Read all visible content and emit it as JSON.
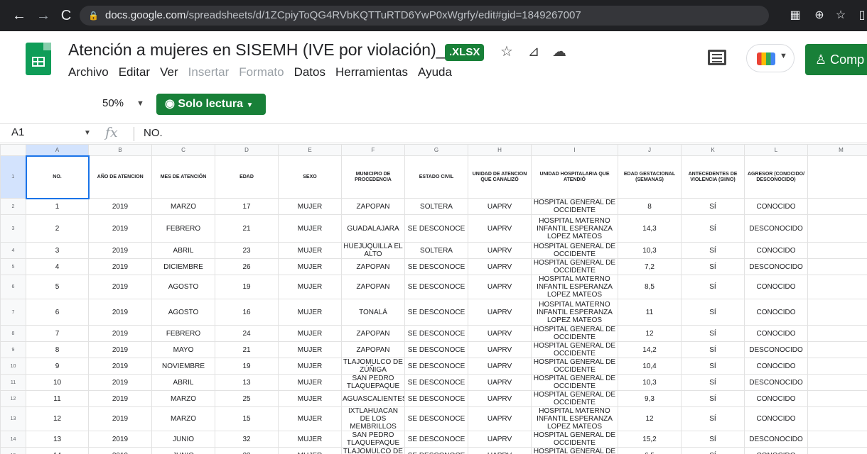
{
  "browser": {
    "url_host": "docs.google.com",
    "url_path": "/spreadsheets/d/1ZCpiyToQG4RVbKQTTuRTD6YwP0xWgrfy/edit#gid=1849267007"
  },
  "doc": {
    "title": "Atención a mujeres en SISEMH (IVE por violación)_1",
    "badge": ".XLSX"
  },
  "menu": {
    "items": [
      "Archivo",
      "Editar",
      "Ver",
      "Insertar",
      "Formato",
      "Datos",
      "Herramientas",
      "Ayuda"
    ],
    "disabled": [
      "Insertar",
      "Formato"
    ]
  },
  "toolbar": {
    "zoom": "50%",
    "mode_label": "Solo lectura"
  },
  "share": {
    "label": "Comp"
  },
  "formula": {
    "cell": "A1",
    "content": "NO."
  },
  "sheet": {
    "col_letters": [
      "A",
      "B",
      "C",
      "D",
      "E",
      "F",
      "G",
      "H",
      "I",
      "J",
      "K",
      "L",
      "M"
    ],
    "headers": [
      "NO.",
      "AÑO DE ATENCION",
      "MES DE ATENCIÓN",
      "EDAD",
      "SEXO",
      "MUNICIPIO DE PROCEDENCIA",
      "ESTADO CIVIL",
      "UNIDAD DE ATENCION QUE CANALIZÓ",
      "UNIDAD HOSPITALARIA QUE ATENDIÓ",
      "EDAD GESTACIONAL (SEMANAS)",
      "ANTECEDENTES DE VIOLENCIA (SI/NO)",
      "AGRESOR (CONOCIDO/ DESCONOCIDO)",
      ""
    ],
    "rows": [
      [
        "1",
        "2019",
        "MARZO",
        "17",
        "MUJER",
        "ZAPOPAN",
        "SOLTERA",
        "UAPRV",
        "HOSPITAL GENERAL DE OCCIDENTE",
        "8",
        "SÍ",
        "CONOCIDO"
      ],
      [
        "2",
        "2019",
        "FEBRERO",
        "21",
        "MUJER",
        "GUADALAJARA",
        "SE DESCONOCE",
        "UAPRV",
        "HOSPITAL MATERNO INFANTIL ESPERANZA LOPEZ MATEOS",
        "14,3",
        "SÍ",
        "DESCONOCIDO"
      ],
      [
        "3",
        "2019",
        "ABRIL",
        "23",
        "MUJER",
        "HUEJUQUILLA EL ALTO",
        "SOLTERA",
        "UAPRV",
        "HOSPITAL GENERAL DE OCCIDENTE",
        "10,3",
        "SÍ",
        "CONOCIDO"
      ],
      [
        "4",
        "2019",
        "DICIEMBRE",
        "26",
        "MUJER",
        "ZAPOPAN",
        "SE DESCONOCE",
        "UAPRV",
        "HOSPITAL GENERAL DE OCCIDENTE",
        "7,2",
        "SÍ",
        "DESCONOCIDO"
      ],
      [
        "5",
        "2019",
        "AGOSTO",
        "19",
        "MUJER",
        "ZAPOPAN",
        "SE DESCONOCE",
        "UAPRV",
        "HOSPITAL MATERNO INFANTIL ESPERANZA LOPEZ MATEOS",
        "8,5",
        "SÍ",
        "CONOCIDO"
      ],
      [
        "6",
        "2019",
        "AGOSTO",
        "16",
        "MUJER",
        "TONALÁ",
        "SE DESCONOCE",
        "UAPRV",
        "HOSPITAL MATERNO INFANTIL ESPERANZA LOPEZ MATEOS",
        "11",
        "SÍ",
        "CONOCIDO"
      ],
      [
        "7",
        "2019",
        "FEBRERO",
        "24",
        "MUJER",
        "ZAPOPAN",
        "SE DESCONOCE",
        "UAPRV",
        "HOSPITAL GENERAL DE OCCIDENTE",
        "12",
        "SÍ",
        "CONOCIDO"
      ],
      [
        "8",
        "2019",
        "MAYO",
        "21",
        "MUJER",
        "ZAPOPAN",
        "SE DESCONOCE",
        "UAPRV",
        "HOSPITAL GENERAL DE OCCIDENTE",
        "14,2",
        "SÍ",
        "DESCONOCIDO"
      ],
      [
        "9",
        "2019",
        "NOVIEMBRE",
        "19",
        "MUJER",
        "TLAJOMULCO DE ZÚÑIGA",
        "SE DESCONOCE",
        "UAPRV",
        "HOSPITAL GENERAL DE OCCIDENTE",
        "10,4",
        "SÍ",
        "CONOCIDO"
      ],
      [
        "10",
        "2019",
        "ABRIL",
        "13",
        "MUJER",
        "SAN PEDRO TLAQUEPAQUE",
        "SE DESCONOCE",
        "UAPRV",
        "HOSPITAL GENERAL DE OCCIDENTE",
        "10,3",
        "SÍ",
        "DESCONOCIDO"
      ],
      [
        "11",
        "2019",
        "MARZO",
        "25",
        "MUJER",
        "AGUASCALIENTES",
        "SE DESCONOCE",
        "UAPRV",
        "HOSPITAL GENERAL DE OCCIDENTE",
        "9,3",
        "SÍ",
        "CONOCIDO"
      ],
      [
        "12",
        "2019",
        "MARZO",
        "15",
        "MUJER",
        "IXTLAHUACAN DE LOS MEMBRILLOS",
        "SE DESCONOCE",
        "UAPRV",
        "HOSPITAL MATERNO INFANTIL ESPERANZA LOPEZ MATEOS",
        "12",
        "SÍ",
        "CONOCIDO"
      ],
      [
        "13",
        "2019",
        "JUNIO",
        "32",
        "MUJER",
        "SAN PEDRO TLAQUEPAQUE",
        "SE DESCONOCE",
        "UAPRV",
        "HOSPITAL GENERAL DE OCCIDENTE",
        "15,2",
        "SÍ",
        "DESCONOCIDO"
      ],
      [
        "14",
        "2019",
        "JUNIO",
        "23",
        "MUJER",
        "TLAJOMULCO DE ZÚÑIGA",
        "SE DESCONOCE",
        "UAPRV",
        "HOSPITAL GENERAL DE OCCIDENTE",
        "6,5",
        "SÍ",
        "CONOCIDO"
      ]
    ]
  }
}
